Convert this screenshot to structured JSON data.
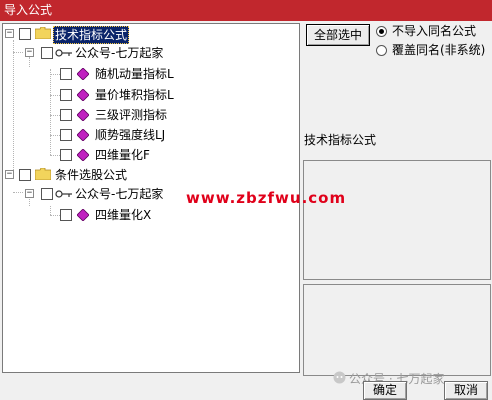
{
  "window": {
    "title": "导入公式"
  },
  "tree": {
    "groups": [
      {
        "label": "技术指标公式",
        "account": "公众号-七万起家",
        "items": [
          "随机动量指标L",
          "量价堆积指标L",
          "三级评测指标",
          "顺势强度线LJ",
          "四维量化F"
        ]
      },
      {
        "label": "条件选股公式",
        "account": "公众号-七万起家",
        "items": [
          "四维量化X"
        ]
      }
    ]
  },
  "controls": {
    "select_all": "全部选中",
    "options": [
      "不导入同名公式",
      "覆盖同名(非系统)"
    ],
    "selected_option": 0
  },
  "info": {
    "category": "技术指标公式"
  },
  "watermark": {
    "url": "www.zbzfwu.com",
    "text": "公众号 · 七万起家"
  },
  "footer": {
    "ok": "确定",
    "cancel": "取消"
  },
  "colors": {
    "title_bar": "#c1272d",
    "selection": "#0a246a",
    "diamond": "#c020c0",
    "folder": "#f2d45c",
    "url": "#e0001a"
  }
}
